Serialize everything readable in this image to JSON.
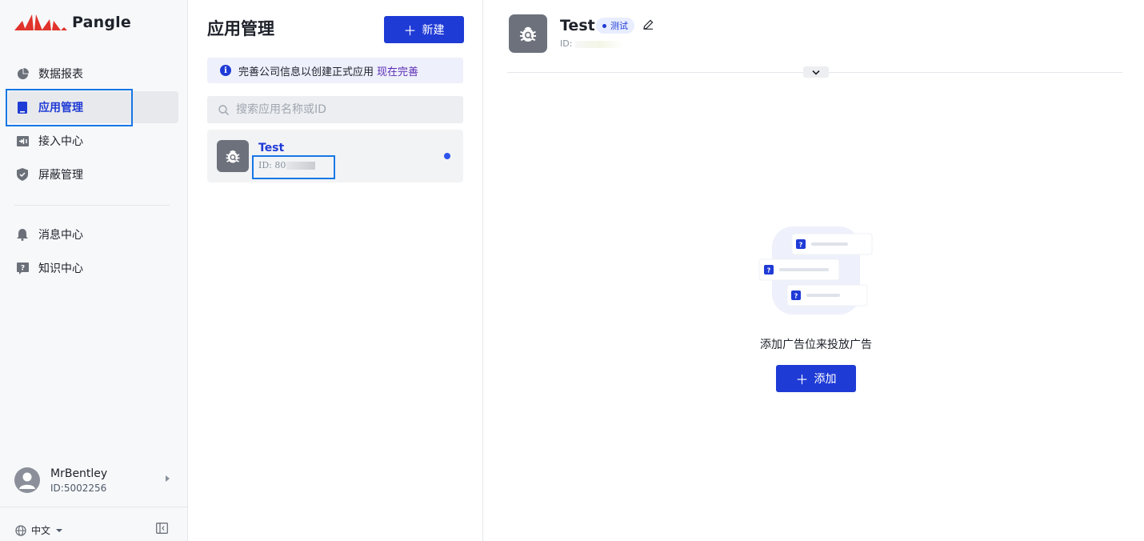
{
  "brand": {
    "name": "Pangle",
    "accent": "#1f3bd6",
    "logo_red": "#e0332b"
  },
  "sidebar": {
    "items": [
      {
        "label": "数据报表",
        "icon": "pie-chart-icon",
        "active": false
      },
      {
        "label": "应用管理",
        "icon": "app-icon",
        "active": true
      },
      {
        "label": "接入中心",
        "icon": "integration-icon",
        "active": false
      },
      {
        "label": "屏蔽管理",
        "icon": "shield-icon",
        "active": false
      },
      {
        "label": "消息中心",
        "icon": "bell-icon",
        "active": false
      },
      {
        "label": "知识中心",
        "icon": "help-icon",
        "active": false
      }
    ],
    "user": {
      "name": "MrBentley",
      "id": "ID:5002256"
    },
    "language": "中文"
  },
  "app_list": {
    "title": "应用管理",
    "new_button": "新建",
    "notice": {
      "text": "完善公司信息以创建正式应用",
      "link": "现在完善"
    },
    "search_placeholder": "搜索应用名称或ID",
    "apps": [
      {
        "name": "Test",
        "id": "ID: 80"
      }
    ]
  },
  "detail": {
    "name": "Test",
    "tag": "测试",
    "id_label": "ID: ",
    "empty_text": "添加广告位来投放广告",
    "add_button": "添加"
  }
}
